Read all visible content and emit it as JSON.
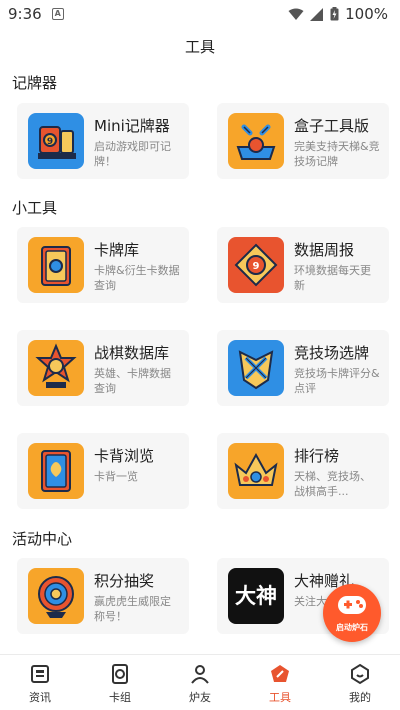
{
  "status_bar": {
    "time": "9:36",
    "notification_badge": "A",
    "battery": "100%"
  },
  "header": {
    "title": "工具"
  },
  "sections": [
    {
      "title": "记牌器",
      "items": [
        {
          "name": "Mini记牌器",
          "desc": "启动游戏即可记牌！",
          "icon": "deck-tracker-icon",
          "bg": "#2f8fe4"
        },
        {
          "name": "盒子工具版",
          "desc": "完美支持天梯&竞技场记牌",
          "icon": "toolbox-icon",
          "bg": "#f7a52a"
        }
      ]
    },
    {
      "title": "小工具",
      "items": [
        {
          "name": "卡牌库",
          "desc": "卡牌&衍生卡数据查询",
          "icon": "card-library-icon",
          "bg": "#f7a52a"
        },
        {
          "name": "数据周报",
          "desc": "环境数据每天更新",
          "icon": "data-weekly-icon",
          "bg": "#e8542f"
        },
        {
          "name": "战棋数据库",
          "desc": "英雄、卡牌数据查询",
          "icon": "battlegrounds-db-icon",
          "bg": "#f7a52a"
        },
        {
          "name": "竞技场选牌",
          "desc": "竞技场卡牌评分&点评",
          "icon": "arena-pick-icon",
          "bg": "#2f8fe4"
        },
        {
          "name": "卡背浏览",
          "desc": "卡背一览",
          "icon": "card-back-icon",
          "bg": "#f7a52a"
        },
        {
          "name": "排行榜",
          "desc": "天梯、竞技场、战棋高手...",
          "icon": "leaderboard-icon",
          "bg": "#f7a52a"
        }
      ]
    },
    {
      "title": "活动中心",
      "items": [
        {
          "name": "积分抽奖",
          "desc": "赢虎虎生威限定称号！",
          "icon": "lottery-icon",
          "bg": "#f7a52a"
        },
        {
          "name": "大神赠礼",
          "desc": "关注大神积分...",
          "icon": "gift-icon",
          "bg": "#111111",
          "badge_text": "大神"
        }
      ]
    }
  ],
  "fab": {
    "label": "启动炉石"
  },
  "tabs": [
    {
      "label": "资讯",
      "icon": "news-icon",
      "active": false
    },
    {
      "label": "卡组",
      "icon": "deck-icon",
      "active": false
    },
    {
      "label": "炉友",
      "icon": "friends-icon",
      "active": false
    },
    {
      "label": "工具",
      "icon": "tools-icon",
      "active": true
    },
    {
      "label": "我的",
      "icon": "profile-icon",
      "active": false
    }
  ],
  "colors": {
    "accent": "#e8542f",
    "card_bg": "#f6f6f6"
  }
}
